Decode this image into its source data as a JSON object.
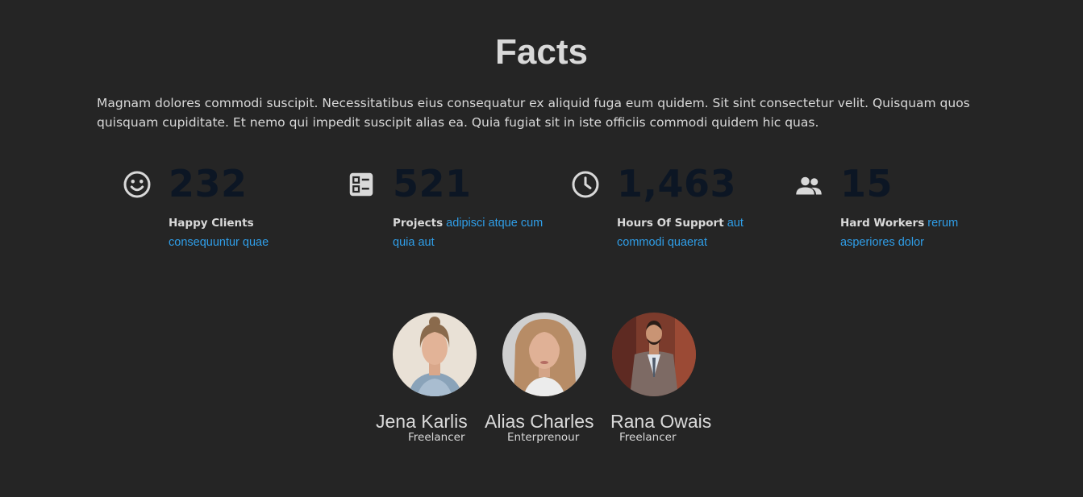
{
  "section": {
    "title": "Facts",
    "intro": "Magnam dolores commodi suscipit. Necessitatibus eius consequatur ex aliquid fuga eum quidem. Sit sint consectetur velit. Quisquam quos quisquam cupiditate. Et nemo qui impedit suscipit alias ea. Quia fugiat sit in iste officiis commodi quidem hic quas."
  },
  "counts": [
    {
      "icon": "smiley-face-icon",
      "number": "232",
      "label": "Happy Clients",
      "text": "consequuntur quae"
    },
    {
      "icon": "list-document-icon",
      "number": "521",
      "label": "Projects",
      "text": "adipisci atque cum quia aut"
    },
    {
      "icon": "clock-icon",
      "number": "1,463",
      "label": "Hours Of Support",
      "text": "aut commodi quaerat"
    },
    {
      "icon": "people-group-icon",
      "number": "15",
      "label": "Hard Workers",
      "text": "rerum asperiores dolor"
    }
  ],
  "team": [
    {
      "name": "Jena Karlis",
      "role": "Freelancer"
    },
    {
      "name": "Alias Charles",
      "role": "Enterprenour"
    },
    {
      "name": "Rana Owais",
      "role": "Freelancer"
    }
  ],
  "colors": {
    "background": "#252525",
    "text": "#d9d9d9",
    "number": "#0c1624",
    "link": "#2f9ee8"
  }
}
